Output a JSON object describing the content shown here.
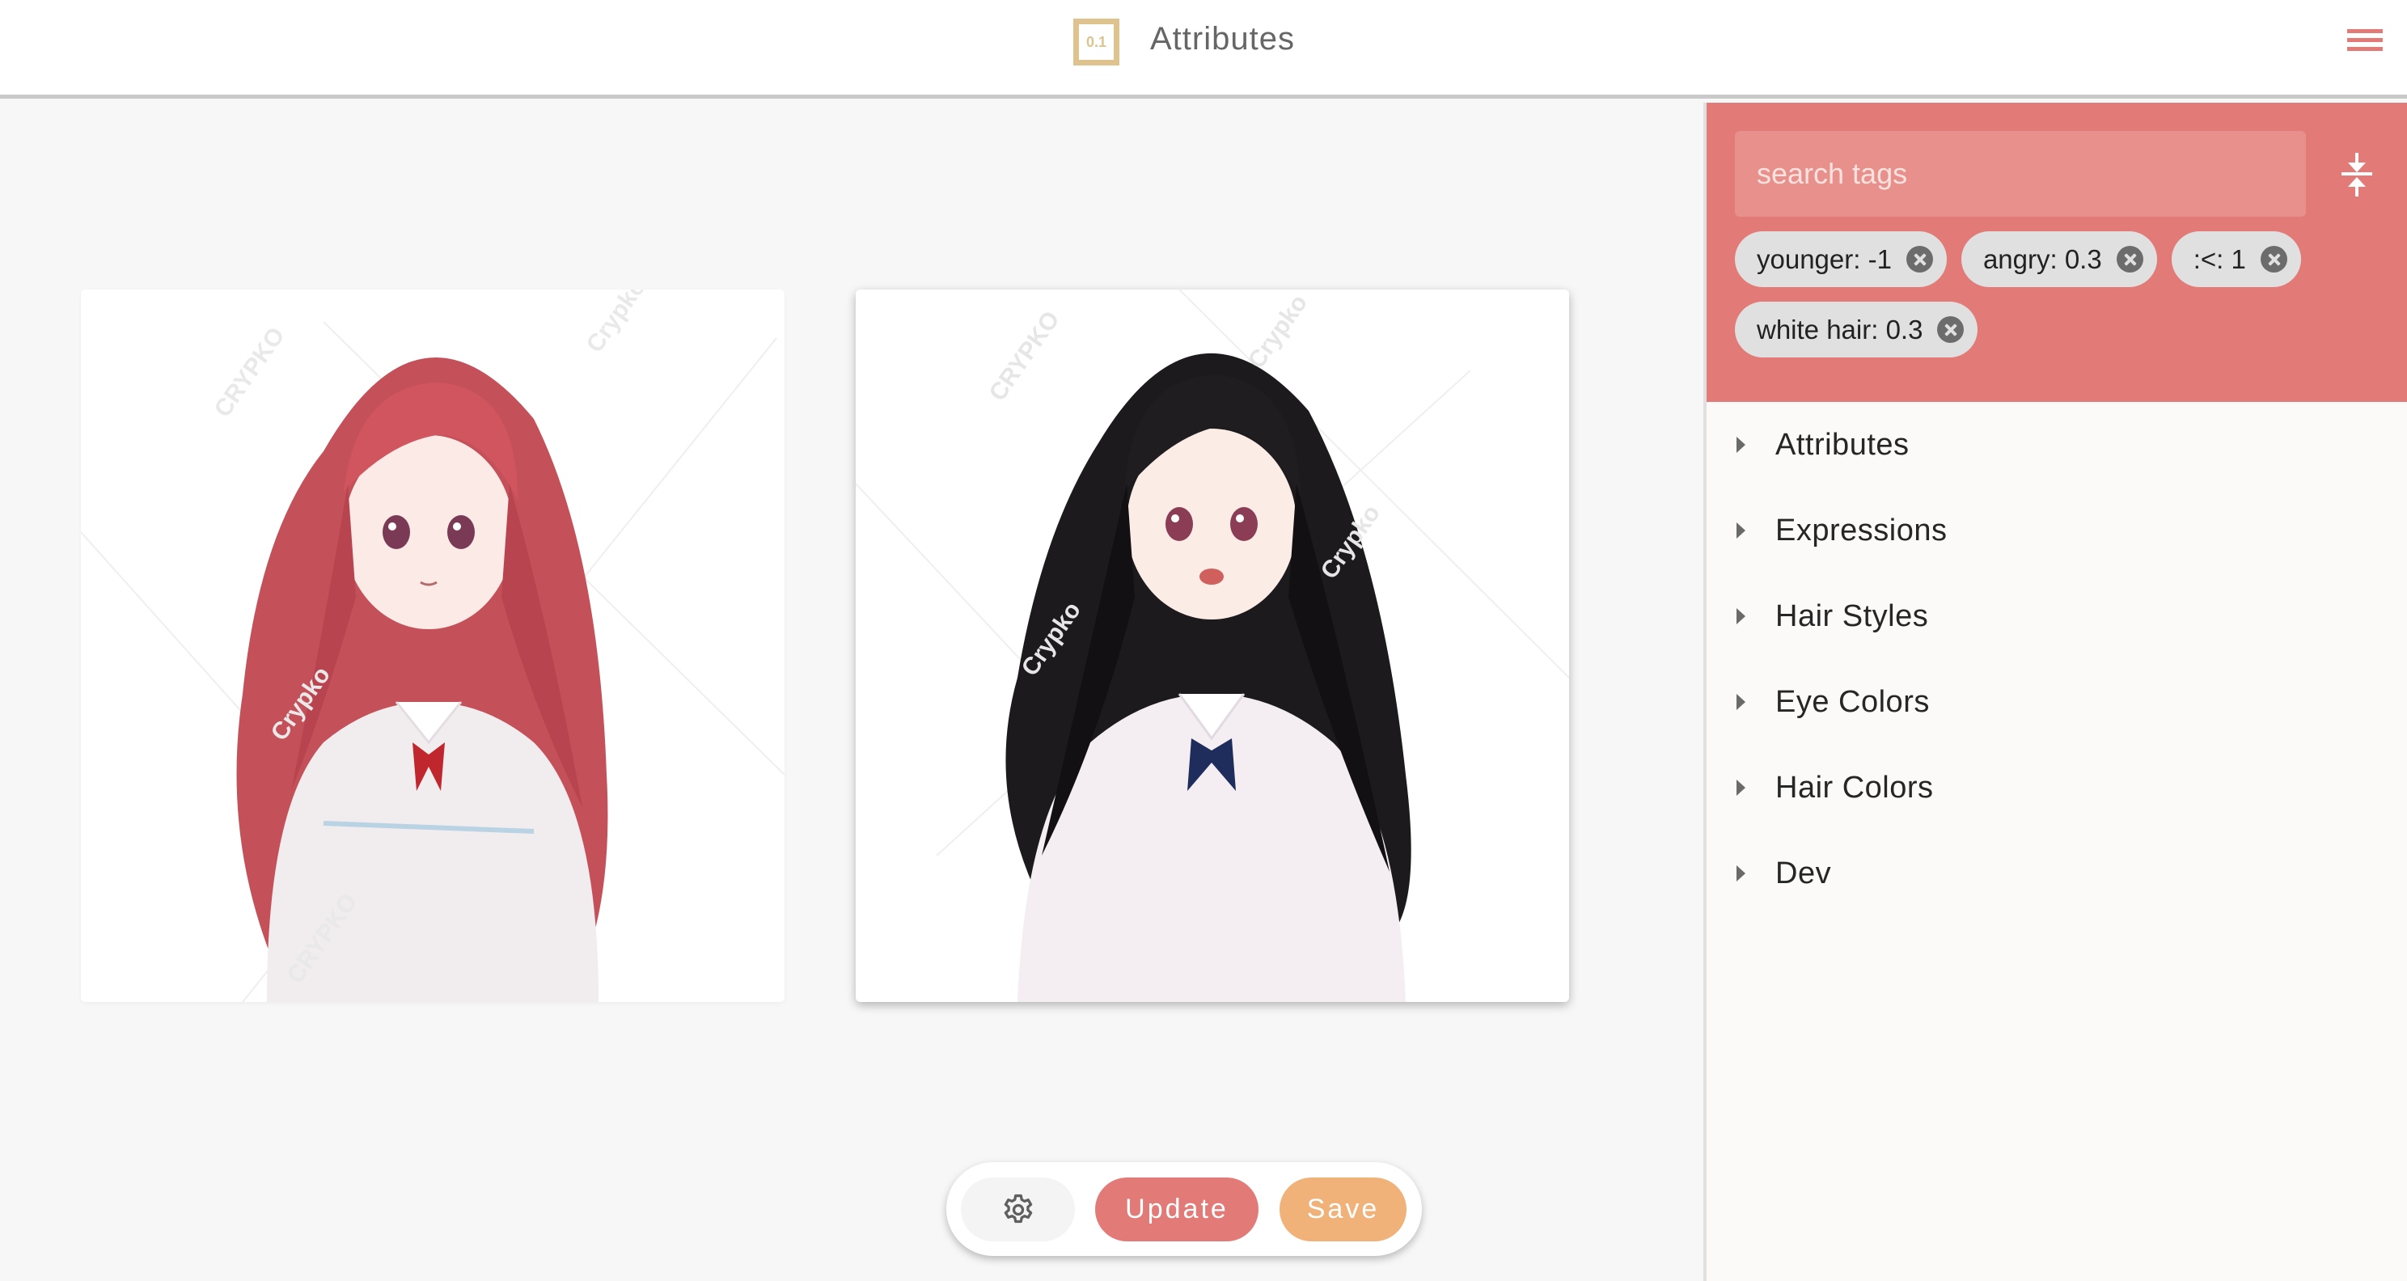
{
  "header": {
    "logo_text": "0.1",
    "title": "Attributes",
    "menu_icon": "hamburger-menu-icon"
  },
  "main": {
    "images": [
      {
        "alt": "Generated character: long red hair, white uniform with red ribbon",
        "hair_color": "#c4515a",
        "watermark": "CRYPKO"
      },
      {
        "alt": "Generated character: long black hair, white uniform with navy ribbon, open mouth",
        "hair_color": "#1c1a1c",
        "watermark": "Crypko"
      }
    ]
  },
  "toolbar": {
    "settings_icon": "gear-icon",
    "update_label": "Update",
    "save_label": "Save",
    "colors": {
      "update": "#e27b77",
      "save": "#f1b27a"
    }
  },
  "panel": {
    "search": {
      "placeholder": "search tags",
      "value": ""
    },
    "collapse_icon": "vertical-align-center-icon",
    "tags": [
      {
        "label": "younger: -1"
      },
      {
        "label": "angry: 0.3"
      },
      {
        "label": ":<: 1"
      },
      {
        "label": "white hair: 0.3"
      }
    ],
    "sections": [
      {
        "label": "Attributes"
      },
      {
        "label": "Expressions"
      },
      {
        "label": "Hair Styles"
      },
      {
        "label": "Eye Colors"
      },
      {
        "label": "Hair Colors"
      },
      {
        "label": "Dev"
      }
    ],
    "accent_color": "#e27b77"
  }
}
